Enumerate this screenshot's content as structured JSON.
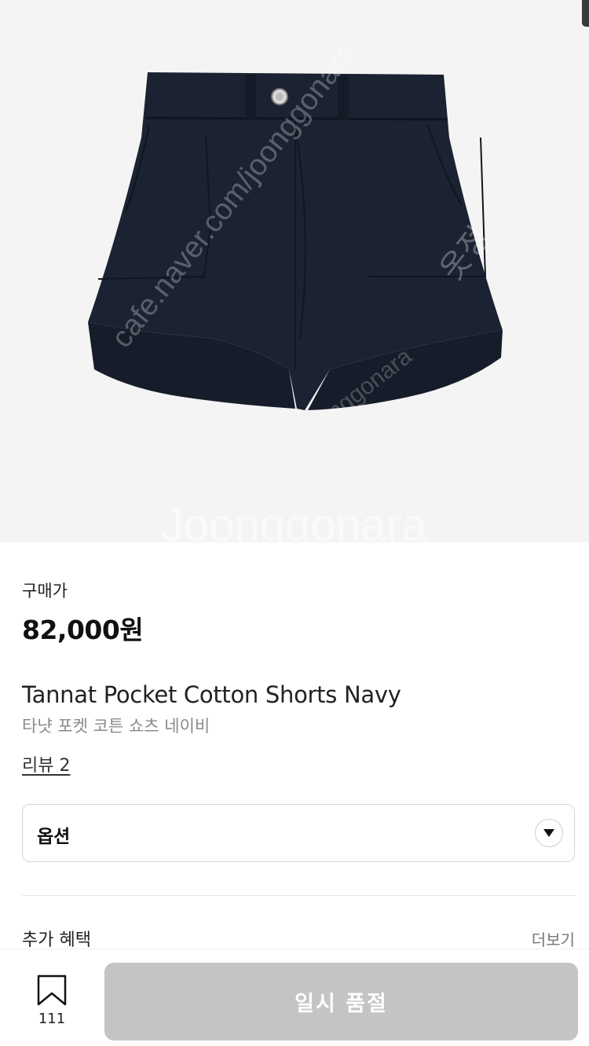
{
  "product": {
    "price_label": "구매가",
    "price": "82,000원",
    "name_en": "Tannat Pocket Cotton Shorts Navy",
    "name_ko": "타냣 포켓 코튼 쇼츠 네이비",
    "review_link": "리뷰 2"
  },
  "option": {
    "label": "옵션"
  },
  "benefits": {
    "label": "추가 혜택",
    "more": "더보기"
  },
  "bottom_bar": {
    "wish_count": "111",
    "button_label": "일시 품절"
  },
  "watermark": {
    "text_1": "cafe.naver.com/joonggonara",
    "text_2": "joonggonara",
    "text_3": "Joonggonara",
    "text_4": "옷정"
  },
  "colors": {
    "shorts": "#1b2231",
    "button_disabled": "#c4c4c4",
    "hero_bg": "#f4f4f4"
  }
}
